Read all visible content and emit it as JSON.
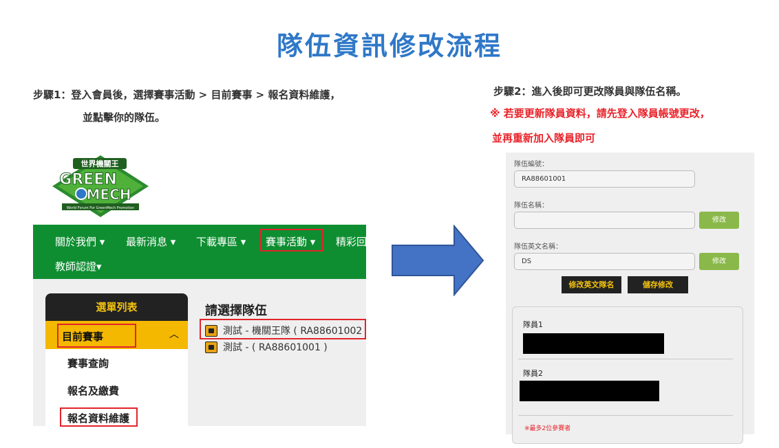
{
  "title": "隊伍資訊修改流程",
  "step1": {
    "line1": "步驟1：登入會員後，選擇賽事活動 > 目前賽事 > 報名資料維護，",
    "line2": "並點擊你的隊伍。"
  },
  "step2": {
    "line1": "步驟2：進入後即可更改隊員與隊伍名稱。",
    "warning_line1": "※ 若要更新隊員資料，請先登入隊員帳號更改，",
    "warning_line2": "並再重新加入隊員即可"
  },
  "logo": {
    "top_text": "世界機關王",
    "line1": "GREEN",
    "line2": "MECH",
    "tagline": "World Forum For GreenMech Promotion"
  },
  "nav": {
    "items": [
      "關於我們 ▾",
      "最新消息 ▾",
      "下載專區 ▾",
      "賽事活動 ▾",
      "精彩回"
    ],
    "row2": "教師認證▾"
  },
  "menu": {
    "header": "選單列表",
    "active": "目前賽事",
    "chevron": "︿",
    "subitems": [
      "賽事查詢",
      "報名及繳費",
      "報名資料維護"
    ]
  },
  "teams": {
    "title": "請選擇隊伍",
    "items": [
      "測試 - 機關王隊 ( RA88601002",
      "測試 - ( RA88601001 )"
    ]
  },
  "form": {
    "team_no_label": "隊伍編號：",
    "team_no_value": "RA88601001",
    "team_name_label": "隊伍名稱：",
    "team_name_value": "",
    "team_en_label": "隊伍英文名稱：",
    "team_en_value": "DS",
    "edit_button": "修改",
    "edit_en_button": "修改英文隊名",
    "save_button": "儲存修改"
  },
  "members": {
    "member1_label": "隊員1",
    "member2_label": "隊員2",
    "note": "※最多2位參賽者"
  },
  "colors": {
    "title": "#2f78c8",
    "warning": "#e8232a",
    "nav_green": "#0e8e31",
    "menu_yellow": "#f4b800",
    "arrow_blue": "#4472c4",
    "button_green": "#8ab84a"
  }
}
